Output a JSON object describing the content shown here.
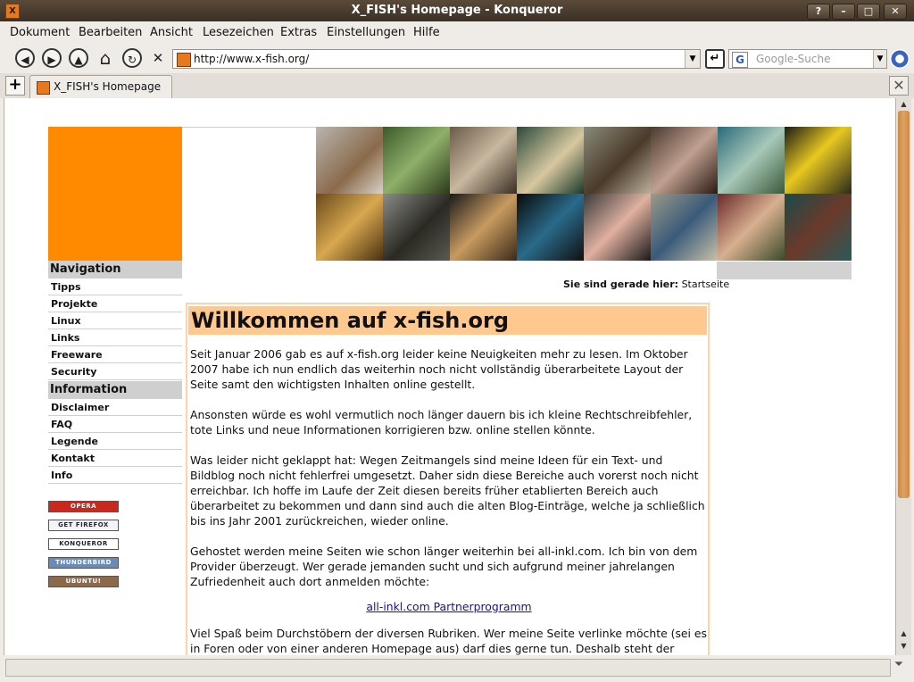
{
  "window": {
    "title": "X_FISH's Homepage - Konqueror",
    "app_icon_letter": "X",
    "buttons": [
      "?",
      "–",
      "□",
      "✕"
    ]
  },
  "menu": [
    "Dokument",
    "Bearbeiten",
    "Ansicht",
    "Lesezeichen",
    "Extras",
    "Einstellungen",
    "Hilfe"
  ],
  "toolbar": {
    "back": "◀",
    "forward": "▶",
    "up": "▲",
    "home": "⌂",
    "reload": "↻",
    "stop": "✕",
    "url": "http://www.x-fish.org/",
    "search_placeholder": "Google-Suche",
    "search_engine_letter": "G"
  },
  "tabs": {
    "new_tab": "+",
    "active": "X_FISH's Homepage",
    "close": "✕"
  },
  "nav": {
    "navigation_heading": "Navigation",
    "navigation_items": [
      "Tipps",
      "Projekte",
      "Linux",
      "Links",
      "Freeware",
      "Security"
    ],
    "information_heading": "Information",
    "information_items": [
      "Disclaimer",
      "FAQ",
      "Legende",
      "Kontakt",
      "Info"
    ]
  },
  "badges": [
    "OPERA",
    "GET FIREFOX",
    "KONQUEROR",
    "THUNDERBIRD",
    "UBUNTU!"
  ],
  "breadcrumb": {
    "label": "Sie sind gerade hier:",
    "value": "Startseite"
  },
  "content": {
    "heading": "Willkommen auf x-fish.org",
    "p1": "Seit Januar 2006 gab es auf x-fish.org leider keine Neuigkeiten mehr zu lesen. Im Oktober 2007 habe ich nun endlich das weiterhin noch nicht vollständig überarbeitete Layout der Seite samt den wichtigsten Inhalten online gestellt.",
    "p2": "Ansonsten würde es wohl vermutlich noch länger dauern bis ich kleine Rechtschreibfehler, tote Links und neue Informationen korrigieren bzw. online stellen könnte.",
    "p3": "Was leider nicht geklappt hat: Wegen Zeitmangels sind meine Ideen für ein Text- und Bildblog noch nicht fehlerfrei umgesetzt. Daher sidn diese Bereiche auch vorerst noch nicht erreichbar. Ich hoffe im Laufe der Zeit diesen bereits früher etablierten Bereich auch überarbeitet zu bekommen und dann sind auch die alten Blog-Einträge, welche ja schließlich bis ins Jahr 2001 zurückreichen, wieder online.",
    "p4": "Gehostet werden meine Seiten wie schon länger weiterhin bei all-inkl.com. Ich bin von dem Provider überzeugt. Wer gerade jemanden sucht und sich aufgrund meiner jahrelangen Zufriedenheit auch dort anmelden möchte:",
    "link": "all-inkl.com Partnerprogramm",
    "p5": "Viel Spaß beim Durchstöbern der diversen Rubriken. Wer meine Seite verlinke möchte (sei es in Foren oder von einer anderen Homepage aus) darf dies gerne tun. Deshalb steht der ganze"
  },
  "colors": {
    "accent_orange": "#ff8a00",
    "heading_bg": "#ffc88f",
    "box_border": "#ffd3a6",
    "nav_head_bg": "#cfcfcf"
  }
}
